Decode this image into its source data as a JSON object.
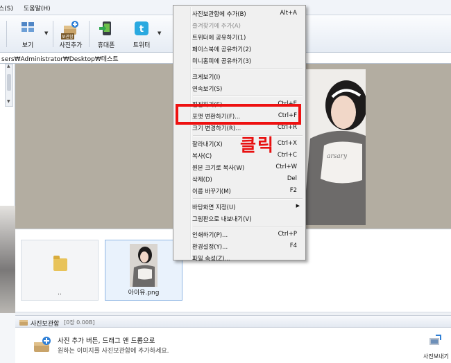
{
  "menubar": {
    "items": [
      "스(S)",
      "도움말(H)"
    ]
  },
  "toolbar": {
    "view_label": "보기",
    "add_label": "사진추가",
    "add_badge": "보관함",
    "phone_label": "휴대폰",
    "twitter_label": "트위터"
  },
  "address": {
    "path": "sers₩Administrator₩Desktop₩테스트"
  },
  "files": [
    {
      "name": ".."
    },
    {
      "name": "아이유.png"
    }
  ],
  "album": {
    "title": "사진보관함",
    "count": "[0장 0.00B]",
    "line1": "사진 추가 버튼, 드래그 앤 드롭으로",
    "line2": "원하는 이미지를 사진보관함에 추가하세요.",
    "viewer_label": "사진보내기"
  },
  "context_menu": {
    "groups": [
      [
        {
          "label": "사진보관함에 추가(B)",
          "shortcut": "Alt+A",
          "disabled": false
        },
        {
          "label": "즐겨찾기에 추가(A)",
          "shortcut": "",
          "disabled": true
        },
        {
          "label": "트위터에 공유하기(1)",
          "shortcut": "",
          "disabled": false
        },
        {
          "label": "페이스북에 공유하기(2)",
          "shortcut": "",
          "disabled": false
        },
        {
          "label": "미니홈피에 공유하기(3)",
          "shortcut": "",
          "disabled": false
        }
      ],
      [
        {
          "label": "크게보기(I)",
          "shortcut": "",
          "disabled": false
        },
        {
          "label": "연속보기(S)",
          "shortcut": "",
          "disabled": false
        }
      ],
      [
        {
          "label": "편집하기(E)",
          "shortcut": "Ctrl+E",
          "disabled": false
        },
        {
          "label": "포맷 변환하기(F)...",
          "shortcut": "Ctrl+F",
          "disabled": false
        },
        {
          "label": "크기 변경하기(R)...",
          "shortcut": "Ctrl+R",
          "disabled": false
        }
      ],
      [
        {
          "label": "잘라내기(X)",
          "shortcut": "Ctrl+X",
          "disabled": false
        },
        {
          "label": "복사(C)",
          "shortcut": "Ctrl+C",
          "disabled": false
        },
        {
          "label": "원본 크기로 복사(W)",
          "shortcut": "Ctrl+W",
          "disabled": false
        },
        {
          "label": "삭제(D)",
          "shortcut": "Del",
          "disabled": false
        },
        {
          "label": "이름 바꾸기(M)",
          "shortcut": "F2",
          "disabled": false
        }
      ],
      [
        {
          "label": "바탕화면 지정(U)",
          "shortcut": "",
          "disabled": false,
          "submenu": true
        },
        {
          "label": "그림판으로 내보내기(V)",
          "shortcut": "",
          "disabled": false
        }
      ],
      [
        {
          "label": "인쇄하기(P)...",
          "shortcut": "Ctrl+P",
          "disabled": false
        },
        {
          "label": "환경설정(Y)...",
          "shortcut": "F4",
          "disabled": false
        },
        {
          "label": "파일 속성(Z)...",
          "shortcut": "",
          "disabled": false
        }
      ]
    ]
  },
  "annotation": {
    "text": "클릭",
    "color": "#ee1111"
  },
  "colors": {
    "preview_bg": "#b3ada1",
    "highlight": "#ee1111",
    "twitter": "#2aa9e0"
  }
}
